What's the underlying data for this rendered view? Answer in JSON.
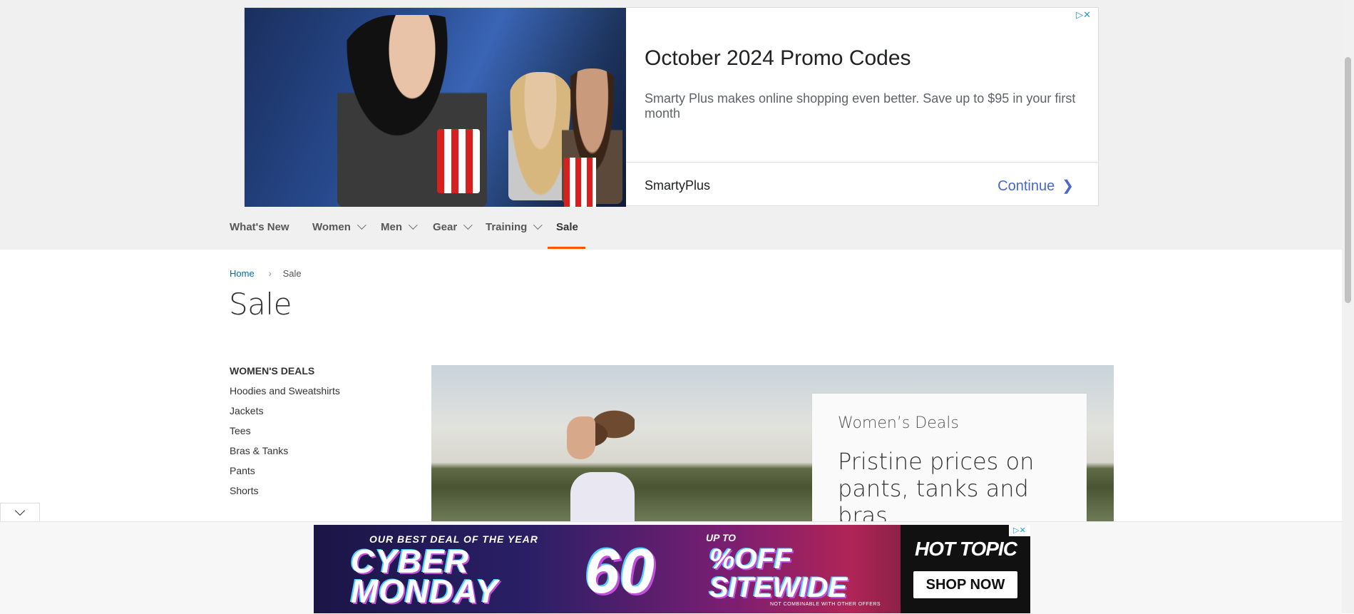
{
  "top_ad": {
    "title": "October 2024 Promo Codes",
    "description": "Smarty Plus makes online shopping even better. Save up to $95 in your first month",
    "sponsor": "SmartyPlus",
    "cta": "Continue",
    "adchoices": "▷✕"
  },
  "nav": {
    "items": [
      {
        "label": "What's New",
        "dropdown": false
      },
      {
        "label": "Women",
        "dropdown": true
      },
      {
        "label": "Men",
        "dropdown": true
      },
      {
        "label": "Gear",
        "dropdown": true
      },
      {
        "label": "Training",
        "dropdown": true
      },
      {
        "label": "Sale",
        "dropdown": false,
        "active": true
      }
    ],
    "active_color": "#ff5501"
  },
  "breadcrumb": {
    "home": "Home",
    "current": "Sale"
  },
  "page_title": "Sale",
  "sidebar": {
    "heading": "WOMEN'S DEALS",
    "links": [
      "Hoodies and Sweatshirts",
      "Jackets",
      "Tees",
      "Bras & Tanks",
      "Pants",
      "Shorts"
    ]
  },
  "hero": {
    "subtitle": "Women’s Deals",
    "title": "Pristine prices on pants, tanks and bras"
  },
  "bottom_ad": {
    "tagline": "OUR BEST DEAL OF THE YEAR",
    "headline": "CYBER MONDAY",
    "up_to": "UP TO",
    "percent": "60",
    "off": "%OFF SITEWIDE",
    "fine_print": "NOT COMBINABLE WITH OTHER OFFERS",
    "brand": "HOT TOPIC",
    "cta": "SHOP NOW",
    "adchoices": "▷✕"
  },
  "colors": {
    "accent": "#ff5501",
    "link": "#006bb4",
    "ad_cta": "#4a67c9"
  }
}
